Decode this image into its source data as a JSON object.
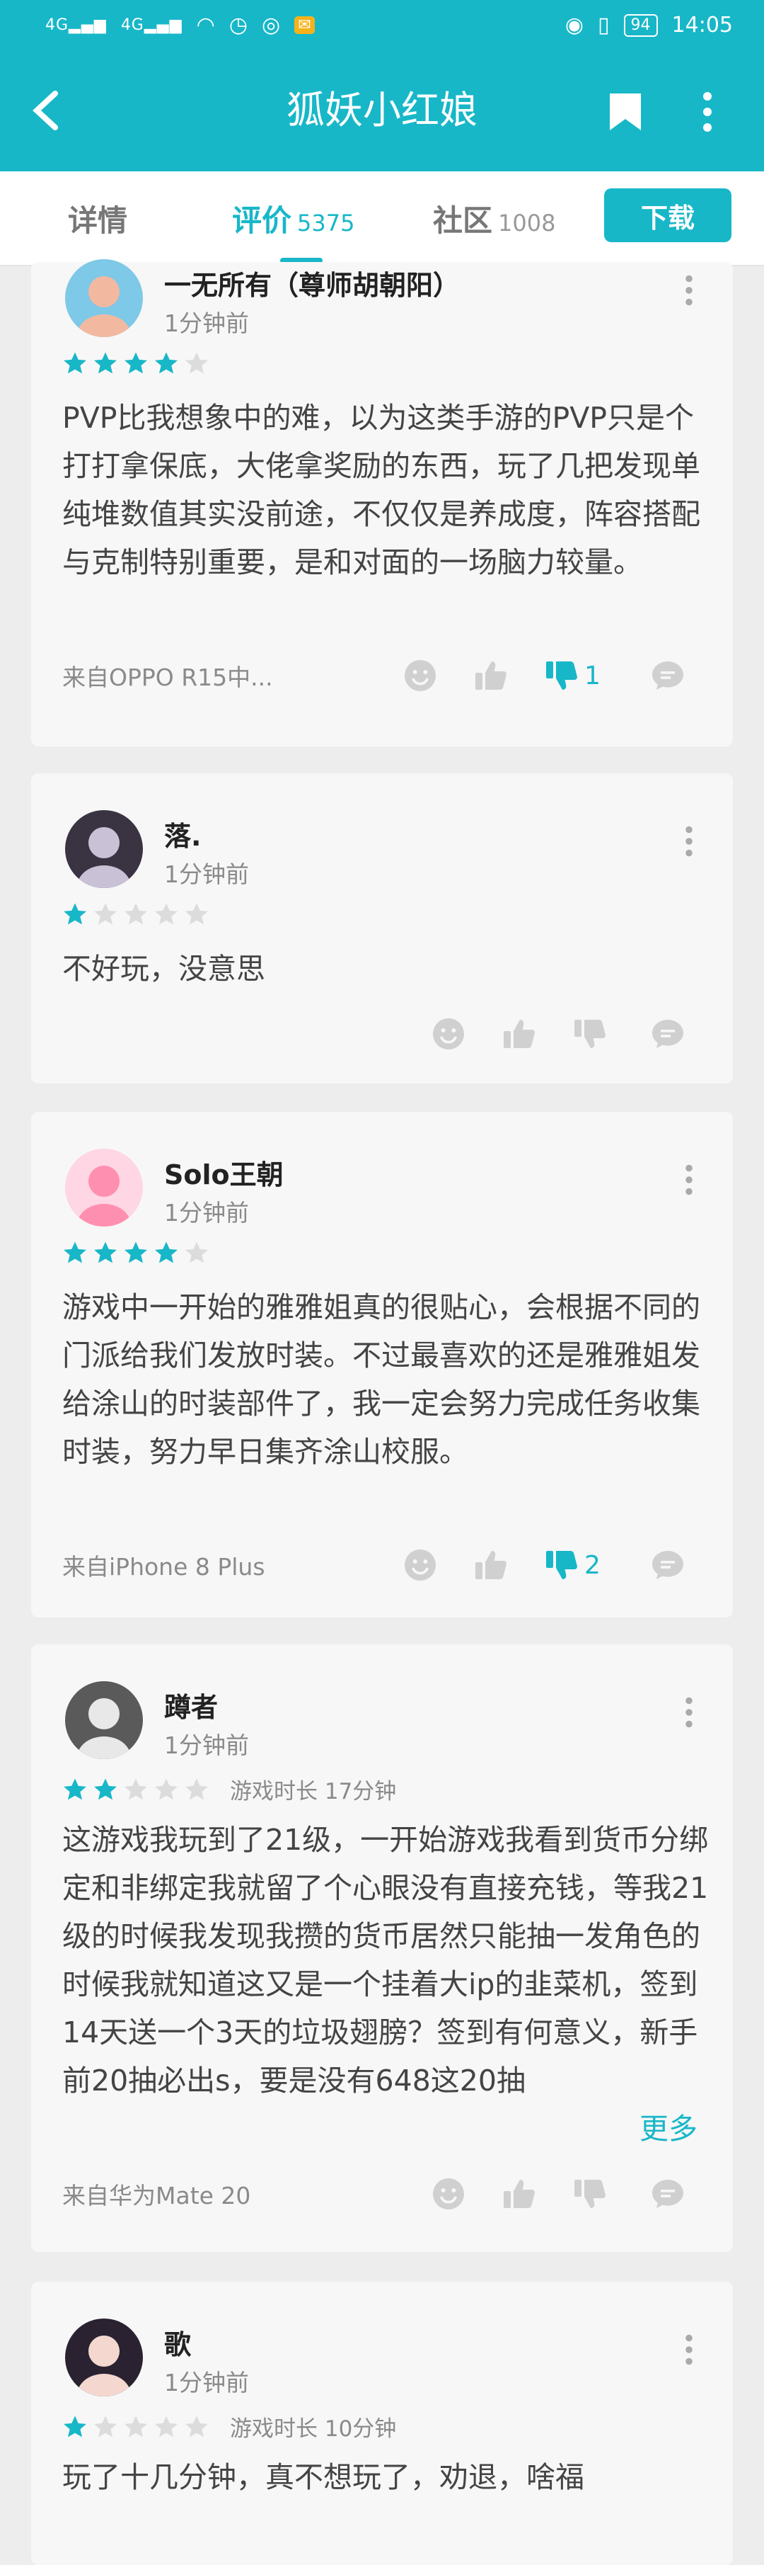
{
  "status_bar": {
    "signal1": "4G",
    "signal2": "4G",
    "battery": "94",
    "time": "14:05"
  },
  "header": {
    "title": "狐妖小红娘"
  },
  "tabs": [
    {
      "label": "详情",
      "count": ""
    },
    {
      "label": "评价",
      "count": "5375"
    },
    {
      "label": "社区",
      "count": "1008"
    }
  ],
  "download_label": "下载",
  "colors": {
    "accent": "#17b7c8",
    "star_empty": "#dcdcdc",
    "icon_gray": "#d0d0d0"
  },
  "reviews": [
    {
      "name": "一无所有（尊师胡朝阳）",
      "time": "1分钟前",
      "rating": 4,
      "playtime": "",
      "text": "PVP比我想象中的难，以为这类手游的PVP只是个打打拿保底，大佬拿奖励的东西，玩了几把发现单纯堆数值其实没前途，不仅仅是养成度，阵容搭配与克制特别重要，是和对面的一场脑力较量。",
      "from": "来自OPPO R15中...",
      "dislike_count": "1"
    },
    {
      "name": "落.",
      "time": "1分钟前",
      "rating": 1,
      "playtime": "",
      "text": "不好玩，没意思",
      "from": "",
      "dislike_count": ""
    },
    {
      "name": "Solo王朝",
      "time": "1分钟前",
      "rating": 4,
      "playtime": "",
      "text": "游戏中一开始的雅雅姐真的很贴心，会根据不同的门派给我们发放时装。不过最喜欢的还是雅雅姐发给涂山的时装部件了，我一定会努力完成任务收集时装，努力早日集齐涂山校服。",
      "from": "来自iPhone 8 Plus",
      "dislike_count": "2"
    },
    {
      "name": "蹲者",
      "time": "1分钟前",
      "rating": 2,
      "playtime": "游戏时长 17分钟",
      "text": "这游戏我玩到了21级，一开始游戏我看到货币分绑定和非绑定我就留了个心眼没有直接充钱，等我21级的时候我发现我攒的货币居然只能抽一发角色的时候我就知道这又是一个挂着大ip的韭菜机，签到14天送一个3天的垃圾翅膀？签到有何意义，新手前20抽必出s，要是没有648这20抽",
      "more": "更多",
      "from": "来自华为Mate 20",
      "dislike_count": ""
    },
    {
      "name": "歌",
      "time": "1分钟前",
      "rating": 1,
      "playtime": "游戏时长 10分钟",
      "text": "玩了十几分钟，真不想玩了，劝退，啥福",
      "from": "",
      "dislike_count": ""
    }
  ]
}
